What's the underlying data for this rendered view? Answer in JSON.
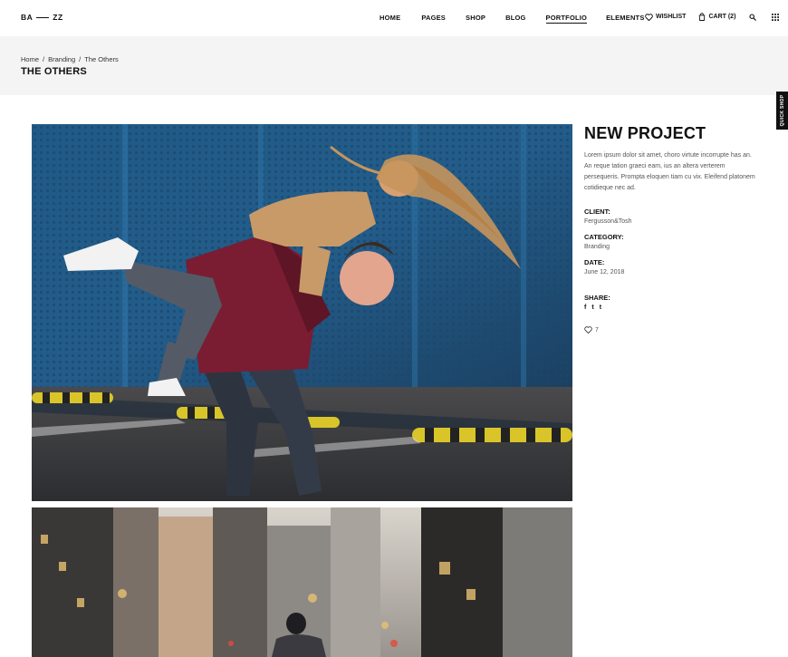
{
  "header": {
    "logo_left": "BA",
    "logo_right": "ZZ",
    "nav": [
      {
        "label": "HOME",
        "active": false
      },
      {
        "label": "PAGES",
        "active": false
      },
      {
        "label": "SHOP",
        "active": false
      },
      {
        "label": "BLOG",
        "active": false
      },
      {
        "label": "PORTFOLIO",
        "active": true
      },
      {
        "label": "ELEMENTS",
        "active": false
      }
    ],
    "wishlist_label": "WISHLIST",
    "cart_label": "CART (2)"
  },
  "breadcrumb": {
    "items": [
      "Home",
      "Branding",
      "The Others"
    ],
    "separator": "/"
  },
  "page_title": "THE OTHERS",
  "quick_shop_label": "QUICK SHOP",
  "project": {
    "title": "NEW PROJECT",
    "description": "Lorem ipsum dolor sit amet, choro virtute incorrupte has an. An reque tation graeci eam, ius an altera verterem persequeris. Prompta eloquen tiam cu vix. Eleifend platonem cotidieque nec ad.",
    "client_label": "CLIENT:",
    "client_value": "Fergusson&Tosh",
    "category_label": "CATEGORY:",
    "category_value": "Branding",
    "date_label": "DATE:",
    "date_value": "June 12, 2018",
    "share_label": "SHARE:",
    "social": [
      "f",
      "t",
      "t"
    ],
    "likes": "7"
  },
  "colors": {
    "band_bg": "#f4f4f4",
    "text": "#111111",
    "muted": "#555555"
  }
}
